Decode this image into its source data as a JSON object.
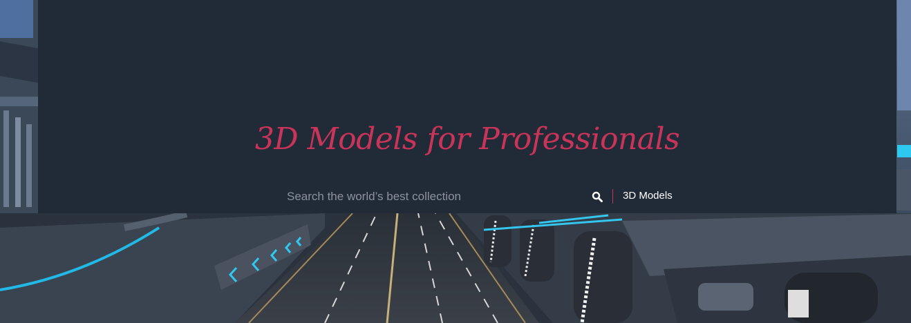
{
  "hero": {
    "headline": "3D Models for Professionals",
    "accent_color": "#c9345a",
    "panel_color": "#212a37"
  },
  "search": {
    "placeholder": "Search the world’s best collection",
    "value": "",
    "button_icon": "search-icon",
    "category": "3D Models"
  },
  "background": {
    "image_subject": "futuristic highway with neon-lit tunnel barriers"
  }
}
